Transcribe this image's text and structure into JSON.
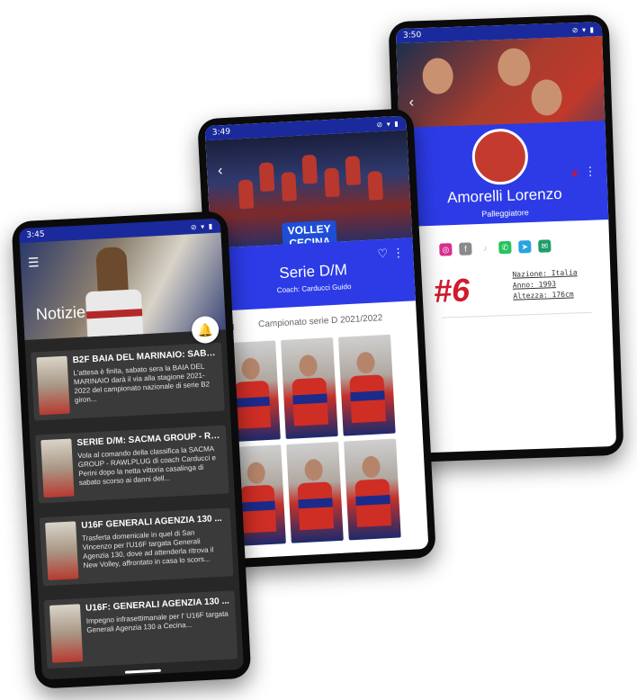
{
  "phone_news": {
    "time": "3:45",
    "title": "Notizie",
    "menu_icon": "hamburger-menu-icon",
    "bell_icon": "bell-icon",
    "items": [
      {
        "title": "B2F BAIA DEL MARINAIO: SABA...",
        "body": "L'attesa è finita, sabato sera la BAIA DEL MARINAIO darà il via alla stagione 2021-2022 del campionato nazionale di serie B2 giron..."
      },
      {
        "title": "SERIE D/M: SACMA GROUP - RA...",
        "body": "Vola al comando della classifica la SACMA GROUP - RAWLPLUG di coach Carducci e Perini dopo la netta vittoria casalinga di sabato scorso ai danni dell..."
      },
      {
        "title": "U16F GENERALI AGENZIA 130 ...",
        "body": "Trasferta domenicale in quel di San Vincenzo per l'U16F targata Generali Agenzia 130, dove ad attenderla ritrova il New Volley, affrontato in casa lo scors..."
      },
      {
        "title": "U16F: GENERALI AGENZIA 130 ...",
        "body": "Impegno infrasettimanale per l' U16F targata Generali Agenzia 130 a Cecina..."
      }
    ]
  },
  "phone_team": {
    "time": "3:49",
    "logo_line1": "VOLLEY",
    "logo_line2": "CECINA",
    "title": "Serie D/M",
    "coach": "Coach: Carducci Guido",
    "championship": "Campionato serie D 2021/2022",
    "back_icon": "back-arrow-icon",
    "heart_icon": "heart-outline-icon",
    "more_icon": "more-vert-icon",
    "external_icon": "open-external-icon",
    "players_count_visible": 6
  },
  "phone_player": {
    "time": "3:50",
    "name": "Amorelli Lorenzo",
    "role": "Palleggiatore",
    "number": "#6",
    "info": [
      "Nazione: Italia",
      "Anno: 1993",
      "Altezza: 176cm"
    ],
    "social": [
      {
        "icon": "instagram-icon",
        "color": "#d6308e"
      },
      {
        "icon": "facebook-icon",
        "color": "#8a8a8a"
      },
      {
        "icon": "tiktok-icon",
        "color": "#cfcfcf"
      },
      {
        "icon": "whatsapp-icon",
        "color": "#25c35a"
      },
      {
        "icon": "telegram-icon",
        "color": "#2aa3e0"
      },
      {
        "icon": "email-icon",
        "color": "#1f9c6a"
      }
    ],
    "heart_icon": "heart-filled-icon",
    "more_icon": "more-vert-icon"
  },
  "colors": {
    "primary_blue": "#2c3be6",
    "status_blue": "#1a2a9c",
    "accent_red": "#d01a2e",
    "dark_bg": "#272727"
  }
}
